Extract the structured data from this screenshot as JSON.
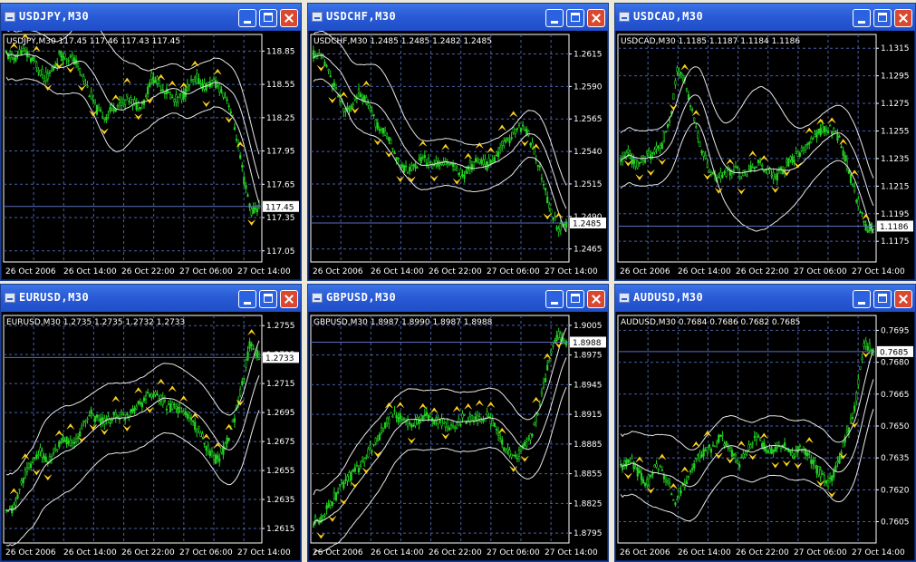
{
  "colors": {
    "candle": "#22d322",
    "band": "#e8e8e8",
    "fractal": "#ffd21c",
    "grid": "#4a5fa8",
    "frame": "#ffffff",
    "hline": "#5a6dc0"
  },
  "x_labels": [
    "26 Oct 2006",
    "26 Oct 14:00",
    "26 Oct 22:00",
    "27 Oct 06:00",
    "27 Oct 14:00"
  ],
  "windows": [
    {
      "title": "USDJPY,M30",
      "legend": "USDJPY,M30  117.45 117.46 117.43 117.45",
      "y_ticks": [
        "118.85",
        "118.55",
        "118.25",
        "117.95",
        "117.65",
        "117.35",
        "117.05"
      ],
      "y_range": [
        117.05,
        118.85
      ],
      "y_min": 116.95,
      "y_max": 119.0,
      "current_price": "117.45",
      "current_value": 117.45,
      "path": [
        118.82,
        118.78,
        118.86,
        118.8,
        118.72,
        118.6,
        118.67,
        118.82,
        118.8,
        118.76,
        118.62,
        118.45,
        118.3,
        118.26,
        118.35,
        118.38,
        118.42,
        118.36,
        118.4,
        118.62,
        118.55,
        118.48,
        118.4,
        118.45,
        118.55,
        118.6,
        118.52,
        118.58,
        118.5,
        118.4,
        118.1,
        117.7,
        117.4,
        117.45
      ],
      "band_width": 0.22,
      "bump_peak": 0.4,
      "extra": 0.3,
      "seed": 11
    },
    {
      "title": "USDCHF,M30",
      "legend": "USDCHF,M30  1.2485 1.2485 1.2482 1.2485",
      "y_ticks": [
        "1.2615",
        "1.2590",
        "1.2565",
        "1.2540",
        "1.2515",
        "1.2490",
        "1.2465"
      ],
      "y_range": [
        1.2465,
        1.2615
      ],
      "y_min": 1.2455,
      "y_max": 1.263,
      "current_price": "1.2485",
      "current_value": 1.2485,
      "path": [
        1.2615,
        1.2612,
        1.26,
        1.2585,
        1.257,
        1.2578,
        1.2586,
        1.2575,
        1.256,
        1.2555,
        1.2545,
        1.253,
        1.2525,
        1.253,
        1.2535,
        1.2528,
        1.2532,
        1.253,
        1.2527,
        1.2522,
        1.253,
        1.2534,
        1.253,
        1.2536,
        1.2545,
        1.2552,
        1.256,
        1.2555,
        1.254,
        1.252,
        1.2495,
        1.248,
        1.2485
      ],
      "band_width": 0.0018,
      "bump_peak": 0.25,
      "extra": 0.0012,
      "seed": 23
    },
    {
      "title": "USDCAD,M30",
      "legend": "USDCAD,M30  1.1185 1.1187 1.1184 1.1186",
      "y_ticks": [
        "1.1315",
        "1.1295",
        "1.1275",
        "1.1255",
        "1.1235",
        "1.1215",
        "1.1195",
        "1.1175"
      ],
      "y_range": [
        1.1175,
        1.1315
      ],
      "y_min": 1.116,
      "y_max": 1.1325,
      "current_price": "1.1186",
      "current_value": 1.1186,
      "path": [
        1.1232,
        1.1238,
        1.123,
        1.1235,
        1.124,
        1.1245,
        1.1262,
        1.13,
        1.129,
        1.1262,
        1.124,
        1.1225,
        1.122,
        1.1225,
        1.1228,
        1.1222,
        1.1228,
        1.1232,
        1.1226,
        1.1222,
        1.1228,
        1.1235,
        1.1238,
        1.1245,
        1.1252,
        1.1258,
        1.1255,
        1.1248,
        1.1225,
        1.1205,
        1.1185,
        1.1186
      ],
      "band_width": 0.002,
      "bump_peak": 0.55,
      "extra": 0.004,
      "seed": 37
    },
    {
      "title": "EURUSD,M30",
      "legend": "EURUSD,M30  1.2735 1.2735 1.2732 1.2733",
      "y_ticks": [
        "1.2755",
        "1.2735",
        "1.2715",
        "1.2695",
        "1.2675",
        "1.2655",
        "1.2635",
        "1.2615"
      ],
      "y_range": [
        1.2615,
        1.2755
      ],
      "y_min": 1.2605,
      "y_max": 1.2762,
      "current_price": "1.2733",
      "current_value": 1.2733,
      "path": [
        1.2625,
        1.263,
        1.265,
        1.266,
        1.2668,
        1.266,
        1.267,
        1.2678,
        1.2672,
        1.2685,
        1.2695,
        1.269,
        1.2688,
        1.2694,
        1.2692,
        1.2698,
        1.2702,
        1.2708,
        1.2705,
        1.27,
        1.2698,
        1.2695,
        1.269,
        1.268,
        1.267,
        1.2662,
        1.2672,
        1.269,
        1.2715,
        1.2745,
        1.2733
      ],
      "band_width": 0.0024,
      "bump_peak": 0.2,
      "extra": 0.0008,
      "seed": 41
    },
    {
      "title": "GBPUSD,M30",
      "legend": "GBPUSD,M30  1.8987 1.8990 1.8987 1.8988",
      "y_ticks": [
        "1.9005",
        "1.8975",
        "1.8945",
        "1.8915",
        "1.8885",
        "1.8855",
        "1.8825",
        "1.8795"
      ],
      "y_range": [
        1.8795,
        1.9005
      ],
      "y_min": 1.8785,
      "y_max": 1.9015,
      "current_price": "1.8988",
      "current_value": 1.8988,
      "path": [
        1.8805,
        1.8812,
        1.8825,
        1.884,
        1.885,
        1.886,
        1.8872,
        1.8885,
        1.89,
        1.8915,
        1.8912,
        1.8905,
        1.8908,
        1.8915,
        1.891,
        1.8905,
        1.89,
        1.891,
        1.8912,
        1.8908,
        1.8912,
        1.89,
        1.888,
        1.887,
        1.888,
        1.8895,
        1.8925,
        1.897,
        1.8995,
        1.8988
      ],
      "band_width": 0.003,
      "bump_peak": 0.2,
      "extra": 0.001,
      "seed": 53
    },
    {
      "title": "AUDUSD,M30",
      "legend": "AUDUSD,M30  0.7684 0.7686 0.7682 0.7685",
      "y_ticks": [
        "0.7695",
        "0.7680",
        "0.7665",
        "0.7650",
        "0.7635",
        "0.7620",
        "0.7605"
      ],
      "y_range": [
        0.7605,
        0.7695
      ],
      "y_min": 0.7595,
      "y_max": 0.7702,
      "current_price": "0.7685",
      "current_value": 0.7685,
      "path": [
        0.763,
        0.7635,
        0.7628,
        0.7622,
        0.7632,
        0.7625,
        0.7615,
        0.7622,
        0.763,
        0.7638,
        0.764,
        0.7645,
        0.764,
        0.7632,
        0.7638,
        0.7645,
        0.764,
        0.7638,
        0.7642,
        0.7636,
        0.764,
        0.7635,
        0.7628,
        0.7622,
        0.7632,
        0.7645,
        0.766,
        0.769,
        0.7685
      ],
      "band_width": 0.0014,
      "bump_peak": 0.2,
      "extra": 0.0005,
      "seed": 67
    }
  ]
}
